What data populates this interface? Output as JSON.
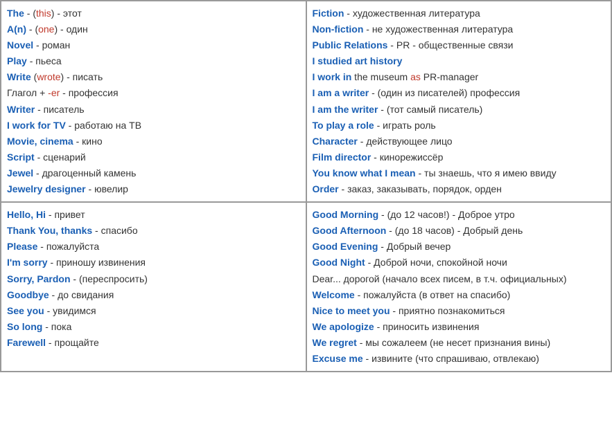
{
  "cells": [
    {
      "id": "top-left",
      "lines": [
        {
          "parts": [
            {
              "text": "The",
              "cls": "en"
            },
            {
              "text": " - (",
              "cls": "ru"
            },
            {
              "text": "this",
              "cls": "en-red"
            },
            {
              "text": ") - этот",
              "cls": "ru"
            }
          ]
        },
        {
          "parts": [
            {
              "text": "A(n)",
              "cls": "en"
            },
            {
              "text": " - (",
              "cls": "ru"
            },
            {
              "text": "one",
              "cls": "en-red"
            },
            {
              "text": ") - один",
              "cls": "ru"
            }
          ]
        },
        {
          "parts": [
            {
              "text": "Novel",
              "cls": "en"
            },
            {
              "text": " - роман",
              "cls": "ru"
            }
          ]
        },
        {
          "parts": [
            {
              "text": "Play",
              "cls": "en"
            },
            {
              "text": " - пьеса",
              "cls": "ru"
            }
          ]
        },
        {
          "parts": [
            {
              "text": "Write",
              "cls": "en"
            },
            {
              "text": " (",
              "cls": "ru"
            },
            {
              "text": "wrote",
              "cls": "en-red"
            },
            {
              "text": ") - писать",
              "cls": "ru"
            }
          ]
        },
        {
          "parts": [
            {
              "text": "Глагол + ",
              "cls": "ru"
            },
            {
              "text": "-er",
              "cls": "en-red"
            },
            {
              "text": " - профессия",
              "cls": "ru"
            }
          ]
        },
        {
          "parts": [
            {
              "text": "Writer",
              "cls": "en"
            },
            {
              "text": " - писатель",
              "cls": "ru"
            }
          ]
        },
        {
          "parts": [
            {
              "text": "I work for TV",
              "cls": "en"
            },
            {
              "text": " - работаю на ТВ",
              "cls": "ru"
            }
          ]
        },
        {
          "parts": [
            {
              "text": "Movie, cinema",
              "cls": "en"
            },
            {
              "text": " - кино",
              "cls": "ru"
            }
          ]
        },
        {
          "parts": [
            {
              "text": "Script",
              "cls": "en"
            },
            {
              "text": " - сценарий",
              "cls": "ru"
            }
          ]
        },
        {
          "parts": [
            {
              "text": "Jewel",
              "cls": "en"
            },
            {
              "text": " - драгоценный камень",
              "cls": "ru"
            }
          ]
        },
        {
          "parts": [
            {
              "text": "Jewelry designer",
              "cls": "en"
            },
            {
              "text": " - ювелир",
              "cls": "ru"
            }
          ]
        }
      ]
    },
    {
      "id": "top-right",
      "lines": [
        {
          "parts": [
            {
              "text": "Fiction",
              "cls": "en"
            },
            {
              "text": " - художественная литература",
              "cls": "ru"
            }
          ]
        },
        {
          "parts": [
            {
              "text": "Non-fiction",
              "cls": "en"
            },
            {
              "text": " - не художественная литература",
              "cls": "ru"
            }
          ]
        },
        {
          "parts": [
            {
              "text": "Public Relations",
              "cls": "en"
            },
            {
              "text": " - PR - общественные связи",
              "cls": "ru"
            }
          ]
        },
        {
          "parts": [
            {
              "text": "I studied art history",
              "cls": "en"
            }
          ]
        },
        {
          "parts": [
            {
              "text": "I work in",
              "cls": "en"
            },
            {
              "text": " the museum ",
              "cls": "ru"
            },
            {
              "text": "as",
              "cls": "en-red"
            },
            {
              "text": " PR-manager",
              "cls": "ru"
            }
          ]
        },
        {
          "parts": [
            {
              "text": "I am a writer",
              "cls": "en"
            },
            {
              "text": " - (один из писателей) профессия",
              "cls": "ru"
            }
          ]
        },
        {
          "parts": [
            {
              "text": "I am the writer",
              "cls": "en"
            },
            {
              "text": " - (тот самый писатель)",
              "cls": "ru"
            }
          ]
        },
        {
          "parts": [
            {
              "text": "To play a role",
              "cls": "en"
            },
            {
              "text": " - играть роль",
              "cls": "ru"
            }
          ]
        },
        {
          "parts": [
            {
              "text": "Character",
              "cls": "en"
            },
            {
              "text": " - действующее лицо",
              "cls": "ru"
            }
          ]
        },
        {
          "parts": [
            {
              "text": "Film director",
              "cls": "en"
            },
            {
              "text": " - кинорежиссёр",
              "cls": "ru"
            }
          ]
        },
        {
          "parts": [
            {
              "text": "You know what I mean",
              "cls": "en"
            },
            {
              "text": " - ты знаешь, что я имею ввиду",
              "cls": "ru"
            }
          ]
        },
        {
          "parts": [
            {
              "text": "Order",
              "cls": "en"
            },
            {
              "text": " - заказ, заказывать, порядок, орден",
              "cls": "ru"
            }
          ]
        }
      ]
    },
    {
      "id": "bottom-left",
      "lines": [
        {
          "parts": [
            {
              "text": "Hello, Hi",
              "cls": "en"
            },
            {
              "text": " - привет",
              "cls": "ru"
            }
          ]
        },
        {
          "parts": [
            {
              "text": "Thank You, thanks",
              "cls": "en"
            },
            {
              "text": " - спасибо",
              "cls": "ru"
            }
          ]
        },
        {
          "parts": [
            {
              "text": "Please",
              "cls": "en"
            },
            {
              "text": " - пожалуйста",
              "cls": "ru"
            }
          ]
        },
        {
          "parts": [
            {
              "text": "I'm sorry",
              "cls": "en"
            },
            {
              "text": " - приношу извинения",
              "cls": "ru"
            }
          ]
        },
        {
          "parts": [
            {
              "text": "Sorry, Pardon",
              "cls": "en"
            },
            {
              "text": " - (переспросить)",
              "cls": "ru"
            }
          ]
        },
        {
          "parts": [
            {
              "text": "Goodbye",
              "cls": "en"
            },
            {
              "text": " - до свидания",
              "cls": "ru"
            }
          ]
        },
        {
          "parts": [
            {
              "text": "See you",
              "cls": "en"
            },
            {
              "text": " - увидимся",
              "cls": "ru"
            }
          ]
        },
        {
          "parts": [
            {
              "text": "So long",
              "cls": "en"
            },
            {
              "text": " - пока",
              "cls": "ru"
            }
          ]
        },
        {
          "parts": [
            {
              "text": "Farewell",
              "cls": "en"
            },
            {
              "text": " - прощайте",
              "cls": "ru"
            }
          ]
        }
      ]
    },
    {
      "id": "bottom-right",
      "lines": [
        {
          "parts": [
            {
              "text": "Good Morning",
              "cls": "en"
            },
            {
              "text": " - (до 12 часов!) - Доброе утро",
              "cls": "ru"
            }
          ]
        },
        {
          "parts": [
            {
              "text": "Good Afternoon",
              "cls": "en"
            },
            {
              "text": " - (до 18 часов) - Добрый день",
              "cls": "ru"
            }
          ]
        },
        {
          "parts": [
            {
              "text": "Good Evening",
              "cls": "en"
            },
            {
              "text": " - Добрый вечер",
              "cls": "ru"
            }
          ]
        },
        {
          "parts": [
            {
              "text": "Good Night",
              "cls": "en"
            },
            {
              "text": " - Доброй ночи, спокойной ночи",
              "cls": "ru"
            }
          ]
        },
        {
          "parts": [
            {
              "text": "Dear...",
              "cls": "ru"
            },
            {
              "text": " дорогой (начало всех писем, в т.ч. официальных)",
              "cls": "ru"
            }
          ]
        },
        {
          "parts": [
            {
              "text": "Welcome",
              "cls": "en"
            },
            {
              "text": " - пожалуйста (в ответ на спасибо)",
              "cls": "ru"
            }
          ]
        },
        {
          "parts": [
            {
              "text": "Nice to meet you",
              "cls": "en"
            },
            {
              "text": " - приятно познакомиться",
              "cls": "ru"
            }
          ]
        },
        {
          "parts": [
            {
              "text": "We apologize",
              "cls": "en"
            },
            {
              "text": " - приносить извинения",
              "cls": "ru"
            }
          ]
        },
        {
          "parts": [
            {
              "text": "We regret",
              "cls": "en"
            },
            {
              "text": " - мы сожалеем (не несет признания вины)",
              "cls": "ru"
            }
          ]
        },
        {
          "parts": [
            {
              "text": "Excuse me",
              "cls": "en"
            },
            {
              "text": " - извините (что спрашиваю, отвлекаю)",
              "cls": "ru"
            }
          ]
        }
      ]
    }
  ]
}
